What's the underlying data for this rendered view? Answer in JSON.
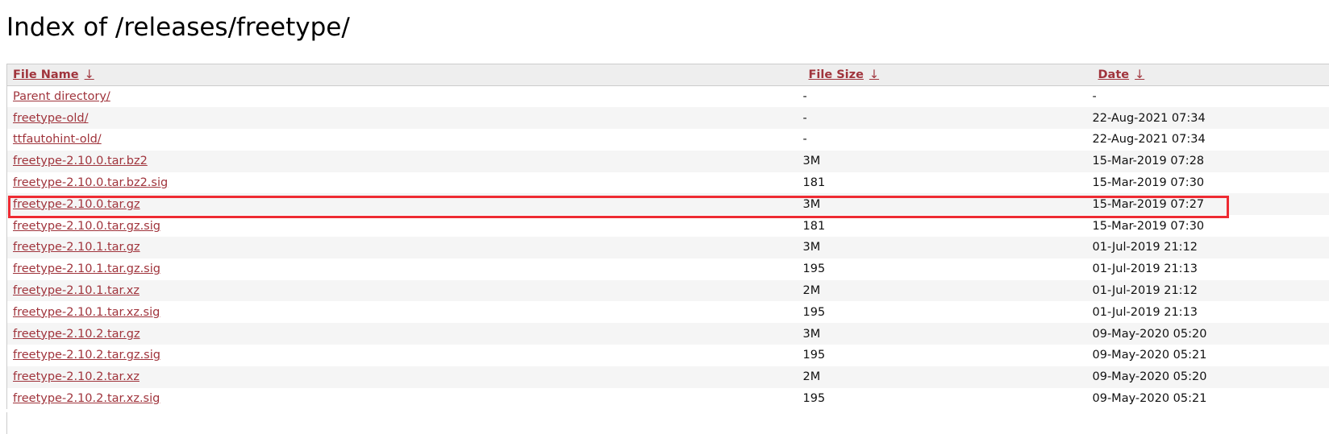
{
  "page": {
    "title": "Index of /releases/freetype/"
  },
  "table": {
    "headers": {
      "name": "File Name",
      "size": "File Size",
      "date": "Date",
      "sort_arrow": "↓"
    },
    "rows": [
      {
        "name": "Parent directory/",
        "size": "-",
        "date": "-"
      },
      {
        "name": "freetype-old/",
        "size": "-",
        "date": "22-Aug-2021 07:34"
      },
      {
        "name": "ttfautohint-old/",
        "size": "-",
        "date": "22-Aug-2021 07:34"
      },
      {
        "name": "freetype-2.10.0.tar.bz2",
        "size": "3M",
        "date": "15-Mar-2019 07:28"
      },
      {
        "name": "freetype-2.10.0.tar.bz2.sig",
        "size": "181",
        "date": "15-Mar-2019 07:30"
      },
      {
        "name": "freetype-2.10.0.tar.gz",
        "size": "3M",
        "date": "15-Mar-2019 07:27"
      },
      {
        "name": "freetype-2.10.0.tar.gz.sig",
        "size": "181",
        "date": "15-Mar-2019 07:30"
      },
      {
        "name": "freetype-2.10.1.tar.gz",
        "size": "3M",
        "date": "01-Jul-2019 21:12"
      },
      {
        "name": "freetype-2.10.1.tar.gz.sig",
        "size": "195",
        "date": "01-Jul-2019 21:13"
      },
      {
        "name": "freetype-2.10.1.tar.xz",
        "size": "2M",
        "date": "01-Jul-2019 21:12"
      },
      {
        "name": "freetype-2.10.1.tar.xz.sig",
        "size": "195",
        "date": "01-Jul-2019 21:13"
      },
      {
        "name": "freetype-2.10.2.tar.gz",
        "size": "3M",
        "date": "09-May-2020 05:20"
      },
      {
        "name": "freetype-2.10.2.tar.gz.sig",
        "size": "195",
        "date": "09-May-2020 05:21"
      },
      {
        "name": "freetype-2.10.2.tar.xz",
        "size": "2M",
        "date": "09-May-2020 05:20"
      },
      {
        "name": "freetype-2.10.2.tar.xz.sig",
        "size": "195",
        "date": "09-May-2020 05:21"
      }
    ]
  },
  "highlight": {
    "row_name": "freetype-2.10.0.tar.gz",
    "color": "#ee2b33"
  },
  "colors": {
    "link": "#a0343c",
    "header_bg": "#eeeeee",
    "stripe_bg": "#f5f5f5"
  }
}
